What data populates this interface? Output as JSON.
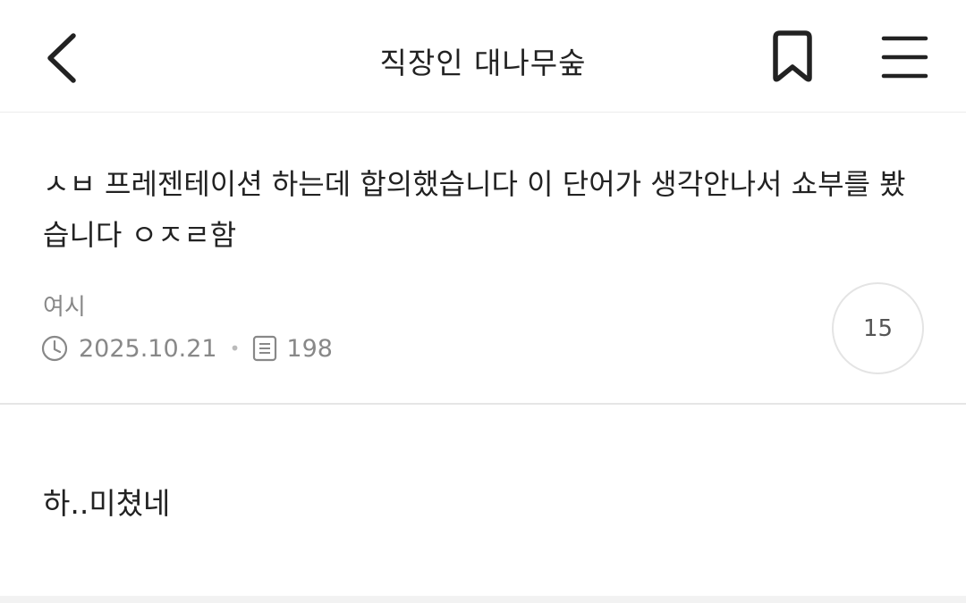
{
  "header": {
    "title": "직장인 대나무숲",
    "back_icon": "chevron-left-icon",
    "bookmark_icon": "bookmark-icon",
    "menu_icon": "hamburger-menu-icon"
  },
  "post": {
    "title": "ㅅㅂ 프레젠테이션 하는데 합의했습니다 이 단어가 생각안나서 쇼부를 봤습니다 ㅇㅈㄹ함",
    "author": "여시",
    "date": "2025.10.21",
    "views": "198",
    "comment_count": "15"
  },
  "body": {
    "text": "하..미쳤네"
  }
}
